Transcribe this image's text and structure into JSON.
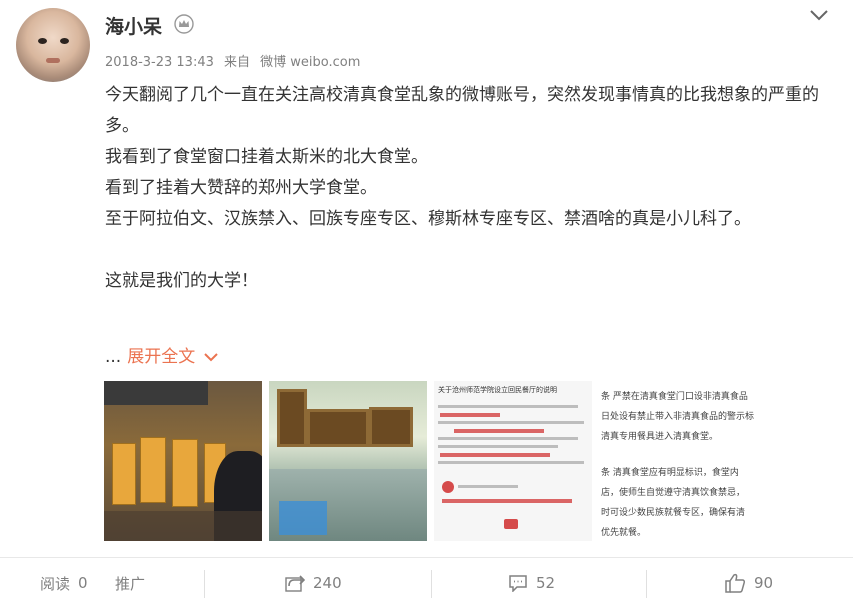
{
  "user": {
    "name": "海小呆"
  },
  "meta": {
    "time": "2018-3-23 13:43",
    "from": "来自",
    "source": "微博 weibo.com"
  },
  "post": {
    "paragraphs": [
      "今天翻阅了几个一直在关注高校清真食堂乱象的微博账号，突然发现事情真的比我想象的严重的多。",
      "我看到了食堂窗口挂着太斯米的北大食堂。",
      "看到了挂着大赞辞的郑州大学食堂。",
      "至于阿拉伯文、汉族禁入、回族专座专区、穆斯林专座专区、禁酒啥的真是小儿科了。",
      "",
      "这就是我们的大学！"
    ],
    "ellipsis": "...",
    "expand_label": "展开全文"
  },
  "photos": {
    "p3_title": "关于沧州师范学院设立回民餐厅的说明",
    "p4_lines": [
      "条  严禁在清真食堂门口设非清真食品",
      "日处设有禁止带入非清真食品的警示标",
      "清真专用餐具进入清真食堂。",
      "条    清真食堂应有明显标识，食堂内",
      "店，使师生自觉遵守清真饮食禁忌，",
      "时可设少数民族就餐专区，确保有清",
      "优先就餐。"
    ]
  },
  "footer": {
    "read_label": "阅读",
    "read_count": "0",
    "promote_label": "推广",
    "repost_count": "240",
    "comment_count": "52",
    "like_count": "90"
  },
  "colors": {
    "link": "#eb7350",
    "muted": "#808080",
    "text": "#333333"
  }
}
